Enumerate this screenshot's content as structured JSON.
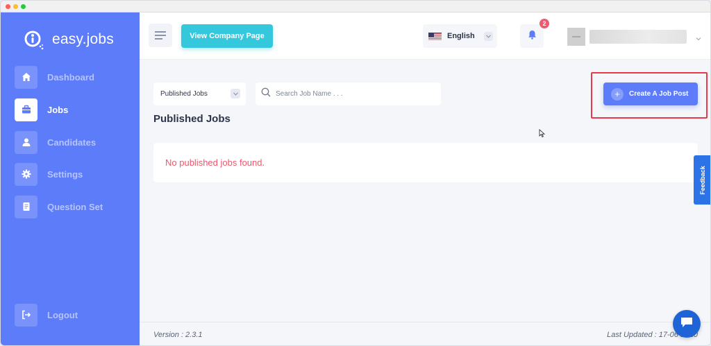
{
  "app": {
    "name": "easy.jobs",
    "brand_color": "#5c7cfa",
    "accent_color": "#35c8dc",
    "alert_color": "#f0566a"
  },
  "sidebar": {
    "items": [
      {
        "label": "Dashboard",
        "icon": "home-icon",
        "active": false
      },
      {
        "label": "Jobs",
        "icon": "briefcase-icon",
        "active": true
      },
      {
        "label": "Candidates",
        "icon": "user-icon",
        "active": false
      },
      {
        "label": "Settings",
        "icon": "gear-icon",
        "active": false
      },
      {
        "label": "Question Set",
        "icon": "document-icon",
        "active": false
      }
    ],
    "logout_label": "Logout"
  },
  "header": {
    "view_company_label": "View Company Page",
    "language": "English",
    "notification_count": "2"
  },
  "main": {
    "filter_value": "Published Jobs",
    "search_placeholder": "Search Job Name . . .",
    "create_button_label": "Create A Job Post",
    "page_title": "Published Jobs",
    "empty_message": "No published jobs found."
  },
  "feedback_label": "Feedback",
  "footer": {
    "version": "Version : 2.3.1",
    "last_updated": "Last Updated : 17-06-2020"
  }
}
